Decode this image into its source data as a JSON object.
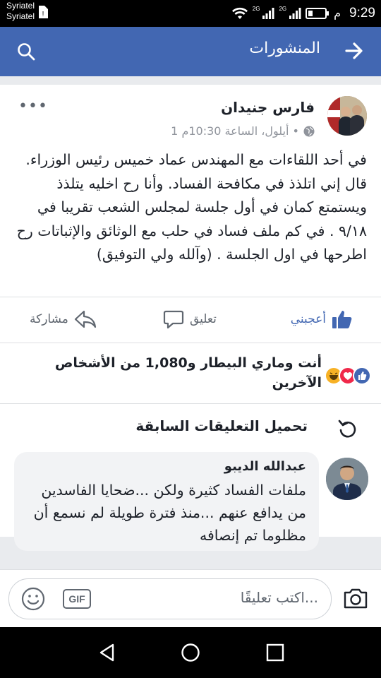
{
  "status_bar": {
    "carrier_1": "Syriatel",
    "carrier_2": "Syriatel",
    "network_1": "2G",
    "network_2": "2G",
    "ampm": "م",
    "time": "9:29"
  },
  "app_bar": {
    "title": "المنشورات",
    "back_icon": "arrow-right-icon",
    "search_icon": "search-icon",
    "color": "#4267b2"
  },
  "post": {
    "author": "فارس جنيدان",
    "meta": "1 أيلول، الساعة 10:30م •",
    "privacy_icon": "globe-icon",
    "text": "في أحد اللقاءات مع المهندس عماد خميس رئيس الوزراء. قال إني اتلذذ في مكافحة الفساد. وأنا رح اخليه يتلذذ ويستمتع كمان في أول جلسة لمجلس الشعب تقريبا في ٩/١٨ . في كم ملف فساد في حلب مع الوثائق والإثباتات رح اطرحها في اول الجلسة . (وآلله ولي التوفيق)",
    "actions": {
      "like": "أعجبني",
      "comment": "تعليق",
      "share": "مشاركة"
    },
    "reactions_text": "أنت وماري البيطار و1,080 من الأشخاص الآخرين"
  },
  "comments": {
    "load_previous": "تحميل التعليقات السابقة",
    "items": [
      {
        "name": "عبدالله الديبو",
        "text": "ملفات الفساد كثيرة ولكن ...ضحايا الفاسدين من يدافع عنهم ...منذ فترة طويلة لم نسمع أن مظلوما تم إنصافه"
      }
    ]
  },
  "composer": {
    "placeholder": "اكتب تعليقًا...",
    "gif_label": "GIF"
  }
}
